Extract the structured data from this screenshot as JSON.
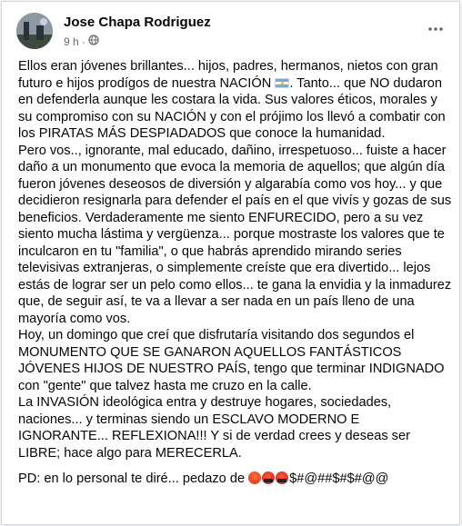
{
  "post": {
    "author": "Jose Chapa Rodriguez",
    "time": "9 h",
    "separator": "·",
    "privacy_icon": "globe-icon",
    "more_icon": "more-horizontal-icon",
    "paragraphs": [
      "Ellos eran jóvenes brillantes... hijos, padres, hermanos, nietos con gran futuro e hijos prodígos de nuestra NACIÓN",
      ". Tanto... que NO dudaron en defenderla aunque les costara la vida. Sus valores éticos, morales y su compromiso con su NACIÓN y con el prójimo los llevó a combatir con los PIRATAS MÁS DESPIADADOS que conoce la humanidad.",
      "Pero vos.., ignorante, mal educado, dañino, irrespetuoso... fuiste a hacer daño a un monumento que evoca la memoria de aquellos; que algún día fueron jóvenes deseosos de diversión y algarabía como vos hoy... y que decidieron resignarla para defender el país en el que vivís y gozas de sus beneficios. Verdaderamente me siento ENFURECIDO, pero a su vez siento mucha lástima y vergüenza... porque mostraste los valores que te inculcaron en tu \"familia\", o que habrás aprendido mirando series televisivas extranjeras, o simplemente creíste que era divertido... lejos estás de lograr ser un pelo como ellos... te gana la envidia y la inmadurez que, de seguir así,  te va a llevar a ser nada en un país lleno de una mayoría como vos.",
      "Hoy, un domingo que creí que disfrutaría visitando dos segundos el MONUMENTO QUE SE GANARON AQUELLOS FANTÁSTICOS JÓVENES HIJOS DE NUESTRO PAÍS, tengo que terminar INDIGNADO con \"gente\"  que talvez hasta me cruzo en la calle.",
      "La INVASIÓN ideológica entra y destruye hogares, sociedades, naciones... y terminas siendo un ESCLAVO MODERNO E IGNORANTE... REFLEXIONA!!! Y si de verdad crees y deseas ser LIBRE; hace algo para MERECERLA."
    ],
    "ps_text": "PD: en lo personal te diré... pedazo de ",
    "ps_suffix": "$#@##$#$#@@",
    "flag_emoji": "argentina-flag-icon",
    "emojis": [
      "angry-face-icon",
      "cursing-face-icon",
      "cursing-face-icon"
    ],
    "colors": {
      "text": "#050505",
      "meta": "#65676b",
      "card": "#ffffff",
      "background": "#f0f2f5"
    }
  }
}
